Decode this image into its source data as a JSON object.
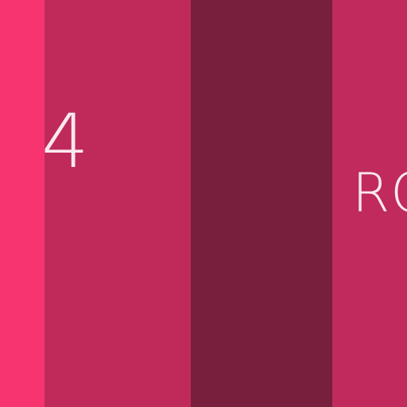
{
  "stripes": [
    {
      "id": "stripe-1",
      "color": "#f7346f"
    },
    {
      "id": "stripe-2",
      "color": "#bf2a5b"
    },
    {
      "id": "stripe-3",
      "color": "#781f3d"
    },
    {
      "id": "stripe-4",
      "color": "#c02a5c"
    }
  ],
  "labels": {
    "number": "4",
    "text": "RO"
  }
}
